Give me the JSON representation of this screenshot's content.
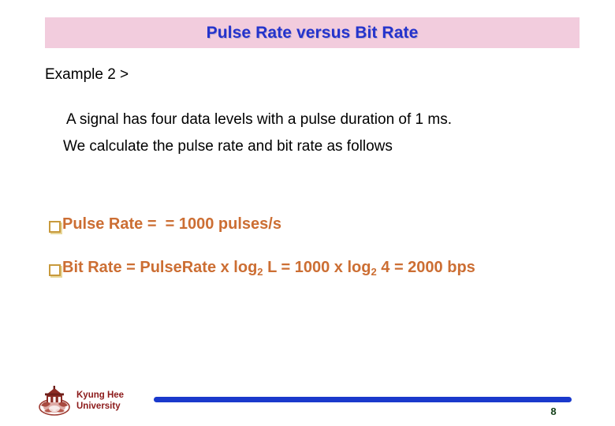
{
  "slide": {
    "title": "Pulse Rate versus Bit Rate",
    "title_color": "#2433CC",
    "title_banner_color": "#F2CCDD",
    "example_label": "Example 2 >",
    "body": {
      "line1": "A signal has four data levels with a pulse duration of 1 ms.",
      "line2": "We calculate the pulse rate and bit rate as follows"
    },
    "bullets": [
      {
        "bullet_icon": "hollow-square-bullet",
        "prefix": "Pulse Rate =  = 1000 pulses/s",
        "has_subscript": false
      },
      {
        "bullet_icon": "hollow-square-bullet",
        "part1": "Bit Rate = PulseRate x log",
        "sub1": "2",
        "part2": " L = 1000 x log",
        "sub2": "2",
        "part3": " 4 = 2000 bps",
        "has_subscript": true
      }
    ],
    "bullet_text_color": "#CC6E33",
    "bullet_glyph_color": "#C89A3C"
  },
  "footer": {
    "logo_icon": "kyung-hee-university-crest",
    "organization_line1": "Kyung Hee",
    "organization_line2": "University",
    "organization_color": "#8C1A1A",
    "rule_color": "#1A39CC",
    "page_number": "8",
    "page_number_color": "#14401A"
  }
}
